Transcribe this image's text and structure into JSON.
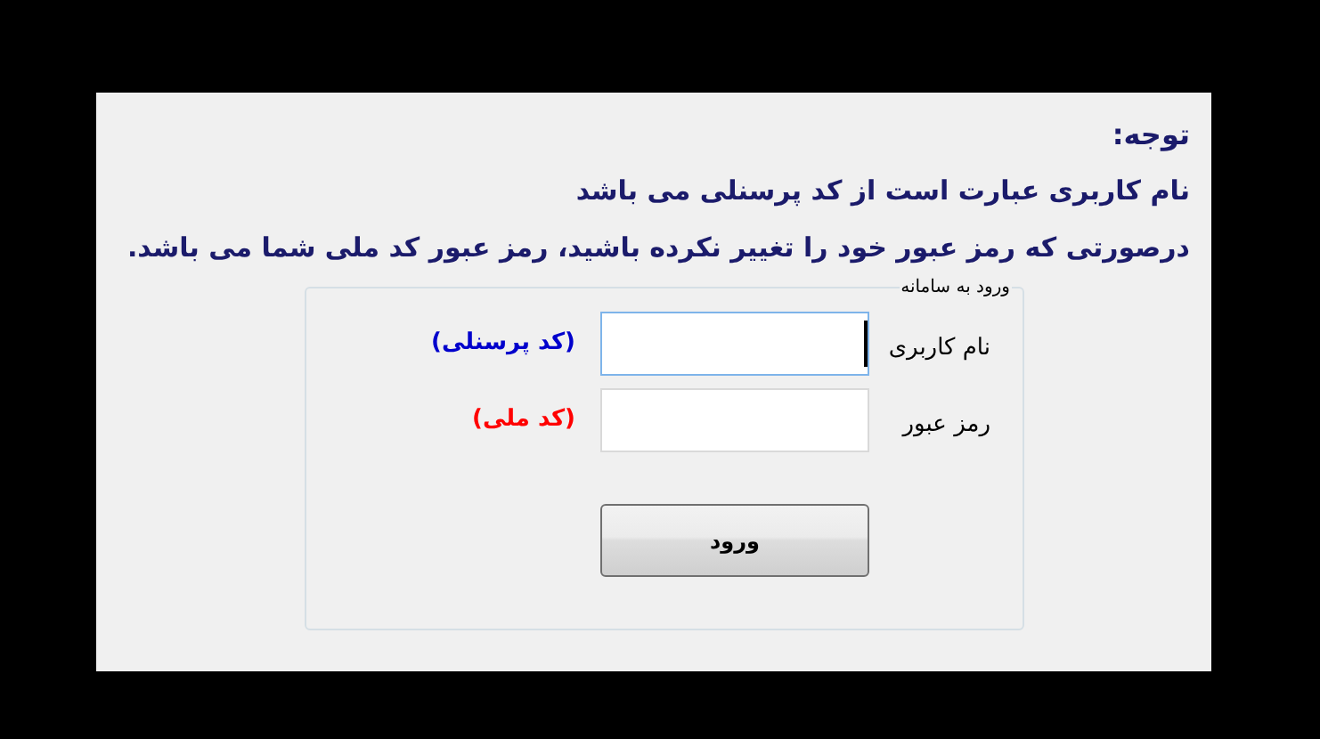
{
  "notice": {
    "title": "توجه:",
    "lines": [
      "نام کاربری عبارت است از کد پرسنلی می باشد",
      "درصورتی که رمز عبور خود را تغییر نکرده باشید، رمز عبور کد ملی شما می باشد."
    ]
  },
  "login": {
    "legend": "ورود به سامانه",
    "fields": [
      {
        "label": "نام کاربری",
        "hint": "(کد پرسنلی)",
        "color": "#0000cc",
        "focused": true
      },
      {
        "label": "رمز عبور",
        "hint": "(کد ملی)",
        "color": "#ff0000",
        "focused": false
      }
    ],
    "submit": "ورود"
  }
}
